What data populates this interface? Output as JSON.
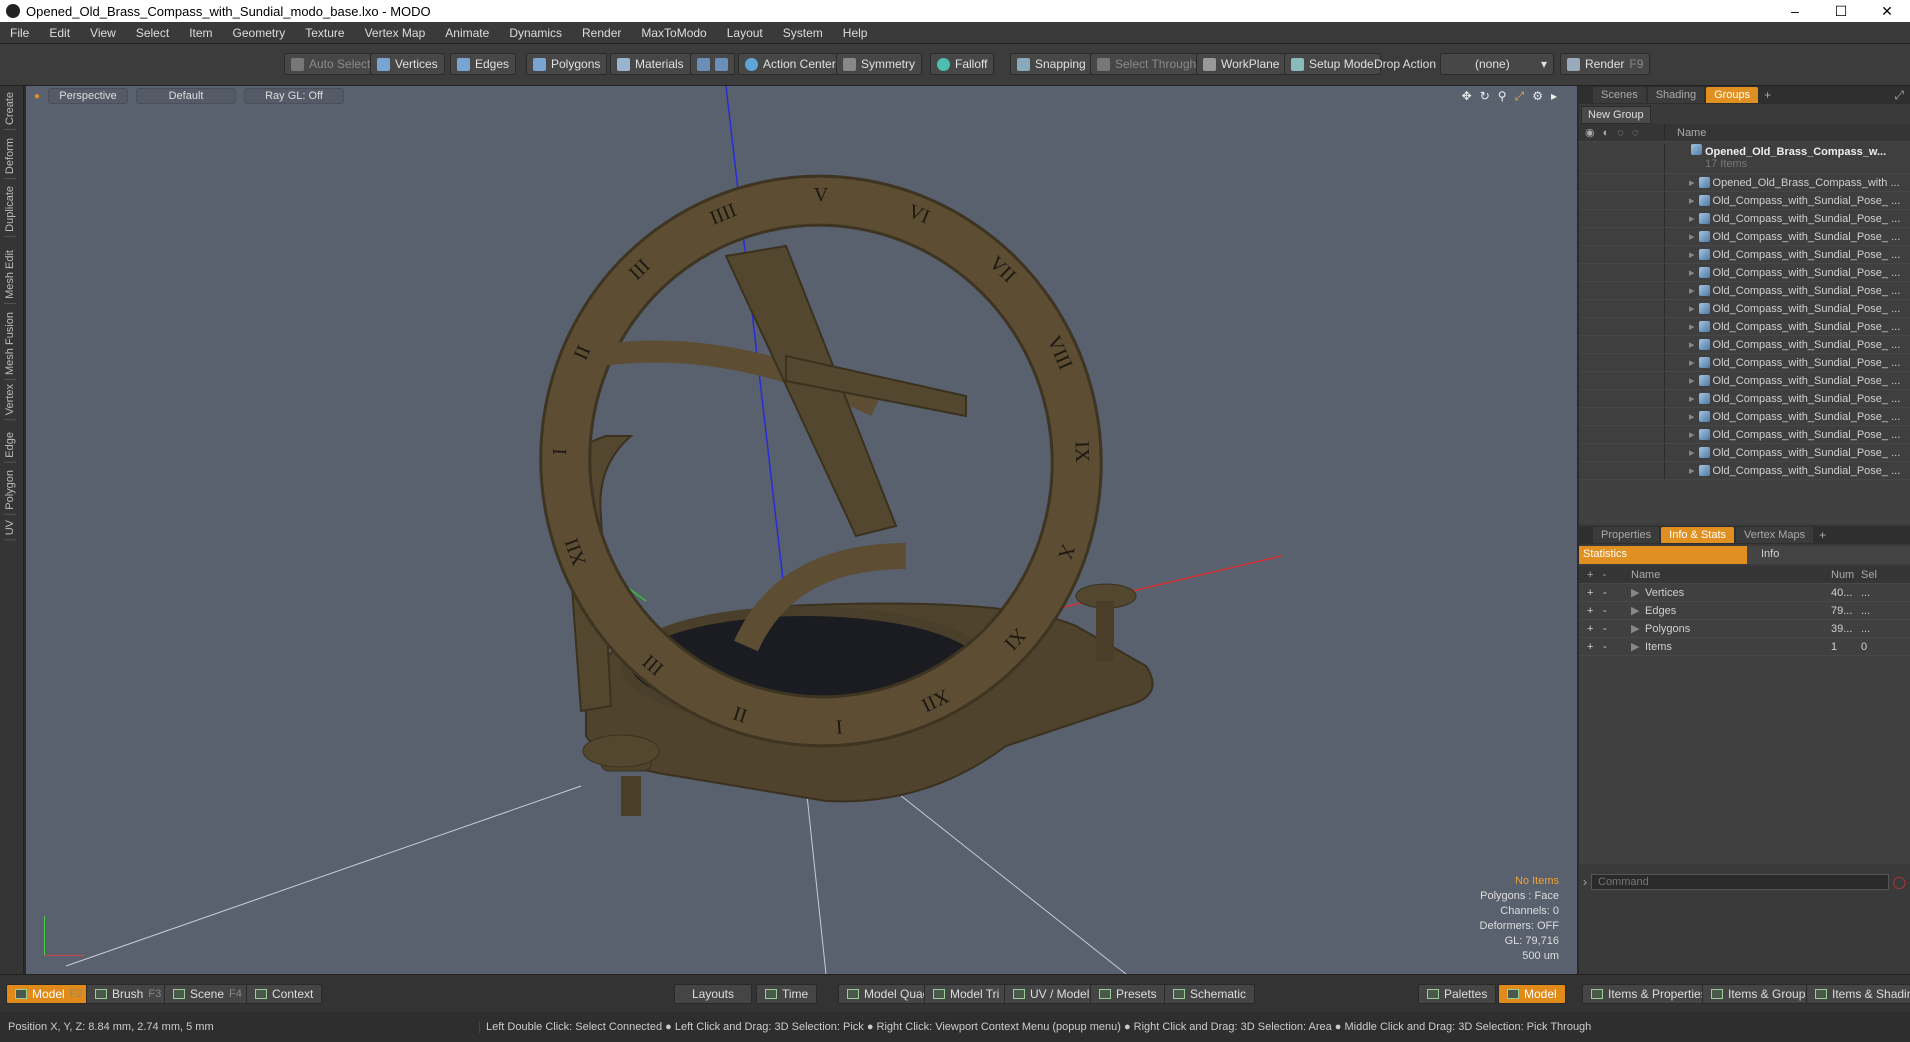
{
  "window": {
    "title": "Opened_Old_Brass_Compass_with_Sundial_modo_base.lxo - MODO",
    "min": "–",
    "max": "☐",
    "close": "✕"
  },
  "menu": [
    "File",
    "Edit",
    "View",
    "Select",
    "Item",
    "Geometry",
    "Texture",
    "Vertex Map",
    "Animate",
    "Dynamics",
    "Render",
    "MaxToModo",
    "Layout",
    "System",
    "Help"
  ],
  "toolbar": {
    "auto_select": "Auto Select",
    "vertices": "Vertices",
    "edges": "Edges",
    "polygons": "Polygons",
    "materials": "Materials",
    "action_center": "Action Center",
    "symmetry": "Symmetry",
    "falloff": "Falloff",
    "snapping": "Snapping",
    "select_through": "Select Through",
    "workplane": "WorkPlane",
    "setup_mode": "Setup Mode",
    "drop_action_label": "Drop Action",
    "drop_action_value": "(none)",
    "render": "Render",
    "render_key": "F9"
  },
  "left_tabs": [
    "Create",
    "Deform",
    "Duplicate",
    "Mesh Edit",
    "Mesh Fusion",
    "Vertex",
    "Edge",
    "Polygon",
    "UV"
  ],
  "viewport": {
    "view": "Perspective",
    "shading": "Default",
    "raygl": "Ray GL: Off",
    "info": {
      "no_items": "No Items",
      "polygons": "Polygons : Face",
      "channels": "Channels: 0",
      "deformers": "Deformers: OFF",
      "gl": "GL: 79,716",
      "scale": "500 um"
    },
    "numerals": [
      "XII",
      "I",
      "II",
      "III",
      "IIII",
      "V",
      "VI",
      "VII",
      "VIII",
      "IX",
      "X",
      "XI",
      "XII",
      "I",
      "II",
      "III"
    ],
    "colors": {
      "bg": "#59616f",
      "brass": "#5c4d33",
      "brass_dark": "#3e3422"
    }
  },
  "scene_panel": {
    "tabs": [
      "Scenes",
      "Shading",
      "Groups"
    ],
    "active_tab": "Groups",
    "new_group": "New Group",
    "name_header": "Name",
    "root": "Opened_Old_Brass_Compass_w...",
    "root_count": "17 Items",
    "items": [
      "Opened_Old_Brass_Compass_with ...",
      "Old_Compass_with_Sundial_Pose_ ...",
      "Old_Compass_with_Sundial_Pose_ ...",
      "Old_Compass_with_Sundial_Pose_ ...",
      "Old_Compass_with_Sundial_Pose_ ...",
      "Old_Compass_with_Sundial_Pose_ ...",
      "Old_Compass_with_Sundial_Pose_ ...",
      "Old_Compass_with_Sundial_Pose_ ...",
      "Old_Compass_with_Sundial_Pose_ ...",
      "Old_Compass_with_Sundial_Pose_ ...",
      "Old_Compass_with_Sundial_Pose_ ...",
      "Old_Compass_with_Sundial_Pose_ ...",
      "Old_Compass_with_Sundial_Pose_ ...",
      "Old_Compass_with_Sundial_Pose_ ...",
      "Old_Compass_with_Sundial_Pose_ ...",
      "Old_Compass_with_Sundial_Pose_ ...",
      "Old_Compass_with_Sundial_Pose_ ..."
    ]
  },
  "info_panel": {
    "tabs": [
      "Properties",
      "Info & Stats",
      "Vertex Maps"
    ],
    "active_tab": "Info & Stats",
    "sub_tabs": [
      "Statistics",
      "Info"
    ],
    "headers": {
      "name": "Name",
      "num": "Num",
      "sel": "Sel"
    },
    "rows": [
      {
        "name": "Vertices",
        "num": "40...",
        "sel": "..."
      },
      {
        "name": "Edges",
        "num": "79...",
        "sel": "..."
      },
      {
        "name": "Polygons",
        "num": "39...",
        "sel": "..."
      },
      {
        "name": "Items",
        "num": "1",
        "sel": "0"
      }
    ],
    "command_placeholder": "Command"
  },
  "bottom": {
    "model": "Model",
    "model_key": "F2",
    "brush": "Brush",
    "brush_key": "F3",
    "scene": "Scene",
    "scene_key": "F4",
    "context": "Context",
    "layouts": "Layouts",
    "time": "Time",
    "model_quad": "Model Quad",
    "model_tri": "Model Tri",
    "uv_model": "UV / Model",
    "presets": "Presets",
    "schematic": "Schematic",
    "palettes": "Palettes",
    "model2": "Model",
    "items_props": "Items & Properties",
    "items_groups": "Items & Groups",
    "items_shading": "Items & Shading"
  },
  "status": {
    "position": "Position X, Y, Z:  8.84 mm, 2.74 mm, 5 mm",
    "hint": "Left Double Click: Select Connected ● Left Click and Drag: 3D Selection: Pick ● Right Click: Viewport Context Menu (popup menu) ● Right Click and Drag: 3D Selection: Area ● Middle Click and Drag: 3D Selection: Pick Through"
  }
}
